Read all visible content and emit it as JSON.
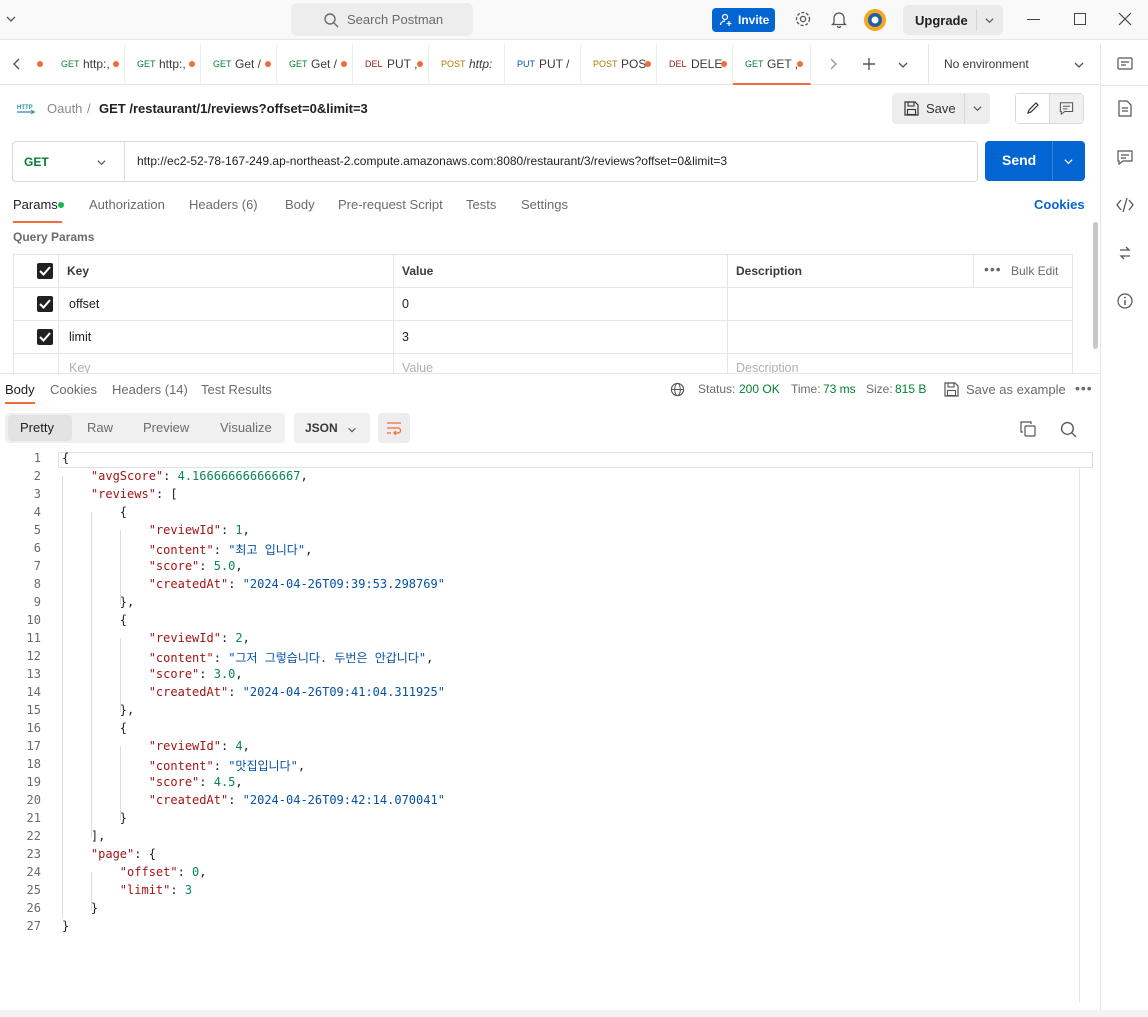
{
  "app": {
    "search_placeholder": "Search Postman",
    "invite_label": "Invite",
    "upgrade_label": "Upgrade"
  },
  "tabs": [
    {
      "method": "GET",
      "name": "http:,",
      "method_color": "#007f31"
    },
    {
      "method": "GET",
      "name": "http:,",
      "method_color": "#007f31"
    },
    {
      "method": "GET",
      "name": "Get /",
      "method_color": "#007f31"
    },
    {
      "method": "GET",
      "name": "Get /",
      "method_color": "#007f31"
    },
    {
      "method": "DEL",
      "name": "PUT ,",
      "method_color": "#8e1a10"
    },
    {
      "method": "POST",
      "name": "http:",
      "method_color": "#ad7a03"
    },
    {
      "method": "PUT",
      "name": "PUT /",
      "method_color": "#0053b8"
    },
    {
      "method": "POST",
      "name": "POS",
      "method_color": "#ad7a03"
    },
    {
      "method": "DEL",
      "name": "DELE",
      "method_color": "#8e1a10"
    },
    {
      "method": "GET",
      "name": "GET ,",
      "method_color": "#007f31"
    }
  ],
  "environment": "No environment",
  "breadcrumb": {
    "collection": "Oauth",
    "separator": "/",
    "request": "GET /restaurant/1/reviews?offset=0&limit=3"
  },
  "save_label": "Save",
  "request": {
    "method": "GET",
    "url": "http://ec2-52-78-167-249.ap-northeast-2.compute.amazonaws.com:8080/restaurant/3/reviews?offset=0&limit=3",
    "send_label": "Send"
  },
  "request_tabs": [
    "Params",
    "Authorization",
    "Headers (6)",
    "Body",
    "Pre-request Script",
    "Tests",
    "Settings"
  ],
  "cookies_label": "Cookies",
  "query_params": {
    "title": "Query Params",
    "headers": {
      "key": "Key",
      "value": "Value",
      "description": "Description",
      "bulk_edit": "Bulk Edit"
    },
    "rows": [
      {
        "key": "offset",
        "value": "0"
      },
      {
        "key": "limit",
        "value": "3"
      }
    ],
    "placeholders": {
      "key": "Key",
      "value": "Value",
      "description": "Description"
    }
  },
  "response_tabs": [
    "Body",
    "Cookies",
    "Headers (14)",
    "Test Results"
  ],
  "response_meta": {
    "status_label": "Status:",
    "status": "200 OK",
    "time_label": "Time:",
    "time": "73 ms",
    "size_label": "Size:",
    "size": "815 B",
    "save_example": "Save as example"
  },
  "view_tabs": [
    "Pretty",
    "Raw",
    "Preview",
    "Visualize"
  ],
  "format": "JSON",
  "code_lines": [
    [
      [
        "p",
        "{"
      ]
    ],
    [
      [
        "p",
        "    "
      ],
      [
        "k",
        "\"avgScore\""
      ],
      [
        "p",
        ": "
      ],
      [
        "n",
        "4.166666666666667"
      ],
      [
        "p",
        ","
      ]
    ],
    [
      [
        "p",
        "    "
      ],
      [
        "k",
        "\"reviews\""
      ],
      [
        "p",
        ": ["
      ]
    ],
    [
      [
        "p",
        "        {"
      ]
    ],
    [
      [
        "p",
        "            "
      ],
      [
        "k",
        "\"reviewId\""
      ],
      [
        "p",
        ": "
      ],
      [
        "n",
        "1"
      ],
      [
        "p",
        ","
      ]
    ],
    [
      [
        "p",
        "            "
      ],
      [
        "k",
        "\"content\""
      ],
      [
        "p",
        ": "
      ],
      [
        "s",
        "\"최고 입니다\""
      ],
      [
        "p",
        ","
      ]
    ],
    [
      [
        "p",
        "            "
      ],
      [
        "k",
        "\"score\""
      ],
      [
        "p",
        ": "
      ],
      [
        "n",
        "5.0"
      ],
      [
        "p",
        ","
      ]
    ],
    [
      [
        "p",
        "            "
      ],
      [
        "k",
        "\"createdAt\""
      ],
      [
        "p",
        ": "
      ],
      [
        "s",
        "\"2024-04-26T09:39:53.298769\""
      ]
    ],
    [
      [
        "p",
        "        },"
      ]
    ],
    [
      [
        "p",
        "        {"
      ]
    ],
    [
      [
        "p",
        "            "
      ],
      [
        "k",
        "\"reviewId\""
      ],
      [
        "p",
        ": "
      ],
      [
        "n",
        "2"
      ],
      [
        "p",
        ","
      ]
    ],
    [
      [
        "p",
        "            "
      ],
      [
        "k",
        "\"content\""
      ],
      [
        "p",
        ": "
      ],
      [
        "s",
        "\"그저 그렇습니다. 두번은 안갑니다\""
      ],
      [
        "p",
        ","
      ]
    ],
    [
      [
        "p",
        "            "
      ],
      [
        "k",
        "\"score\""
      ],
      [
        "p",
        ": "
      ],
      [
        "n",
        "3.0"
      ],
      [
        "p",
        ","
      ]
    ],
    [
      [
        "p",
        "            "
      ],
      [
        "k",
        "\"createdAt\""
      ],
      [
        "p",
        ": "
      ],
      [
        "s",
        "\"2024-04-26T09:41:04.311925\""
      ]
    ],
    [
      [
        "p",
        "        },"
      ]
    ],
    [
      [
        "p",
        "        {"
      ]
    ],
    [
      [
        "p",
        "            "
      ],
      [
        "k",
        "\"reviewId\""
      ],
      [
        "p",
        ": "
      ],
      [
        "n",
        "4"
      ],
      [
        "p",
        ","
      ]
    ],
    [
      [
        "p",
        "            "
      ],
      [
        "k",
        "\"content\""
      ],
      [
        "p",
        ": "
      ],
      [
        "s",
        "\"맛집입니다\""
      ],
      [
        "p",
        ","
      ]
    ],
    [
      [
        "p",
        "            "
      ],
      [
        "k",
        "\"score\""
      ],
      [
        "p",
        ": "
      ],
      [
        "n",
        "4.5"
      ],
      [
        "p",
        ","
      ]
    ],
    [
      [
        "p",
        "            "
      ],
      [
        "k",
        "\"createdAt\""
      ],
      [
        "p",
        ": "
      ],
      [
        "s",
        "\"2024-04-26T09:42:14.070041\""
      ]
    ],
    [
      [
        "p",
        "        }"
      ]
    ],
    [
      [
        "p",
        "    ],"
      ]
    ],
    [
      [
        "p",
        "    "
      ],
      [
        "k",
        "\"page\""
      ],
      [
        "p",
        ": {"
      ]
    ],
    [
      [
        "p",
        "        "
      ],
      [
        "k",
        "\"offset\""
      ],
      [
        "p",
        ": "
      ],
      [
        "n",
        "0"
      ],
      [
        "p",
        ","
      ]
    ],
    [
      [
        "p",
        "        "
      ],
      [
        "k",
        "\"limit\""
      ],
      [
        "p",
        ": "
      ],
      [
        "n",
        "3"
      ]
    ],
    [
      [
        "p",
        "    }"
      ]
    ],
    [
      [
        "p",
        "}"
      ]
    ]
  ],
  "colors": {
    "accent": "#f26b3a",
    "primary": "#0265d2",
    "get_green": "#007f31",
    "json_key": "#a31515",
    "json_string": "#0451a5",
    "json_number": "#098658"
  }
}
